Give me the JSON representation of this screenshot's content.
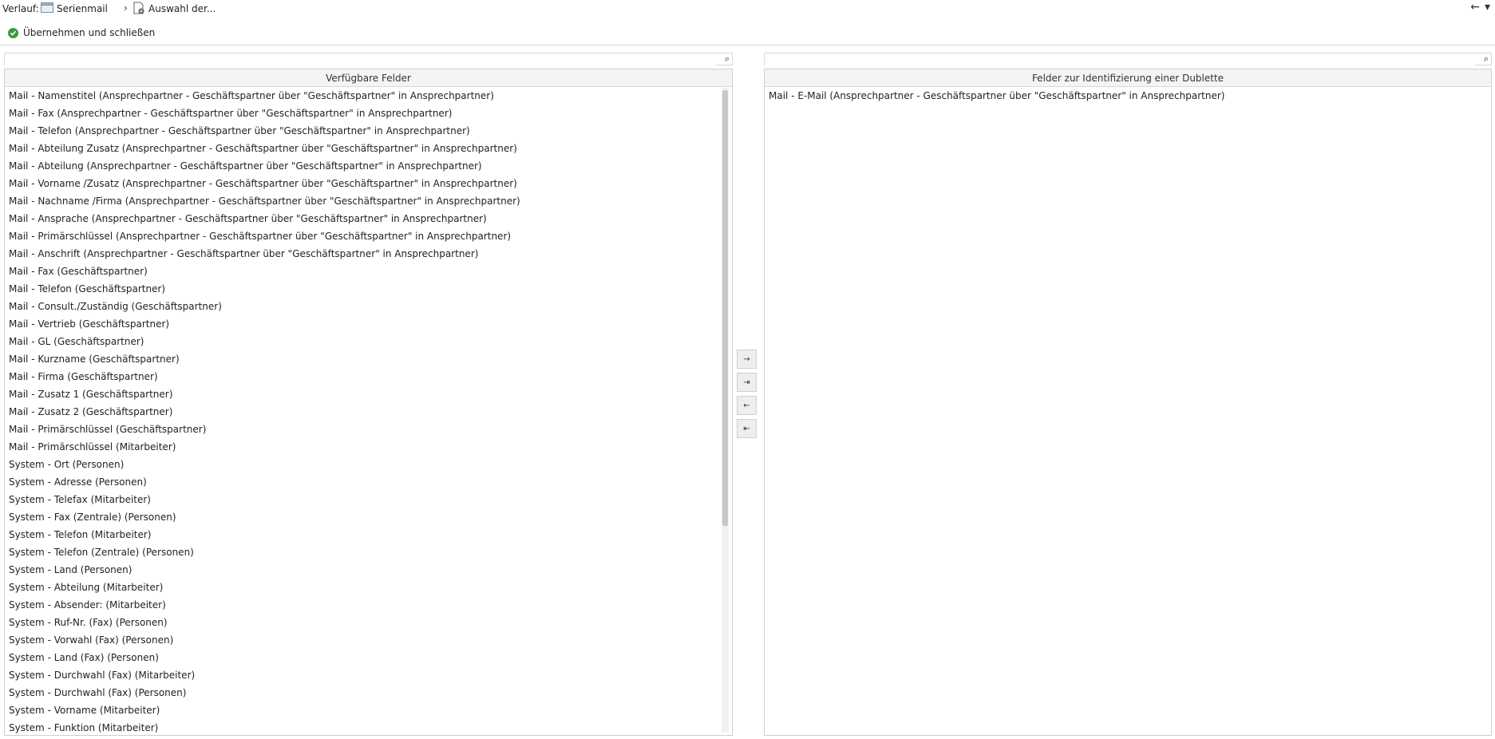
{
  "breadcrumb": {
    "label": "Verlauf:",
    "items": [
      {
        "label": "Serienmail",
        "icon": "window-icon"
      },
      {
        "label": "Auswahl der...",
        "icon": "document-gear-icon"
      }
    ]
  },
  "top_right": {
    "back_icon": "←",
    "menu_icon": "▾"
  },
  "toolbar": {
    "apply_close_label": "Übernehmen und schließen"
  },
  "search_icon": "⌕",
  "left_panel": {
    "header": "Verfügbare Felder",
    "search_value": "",
    "items": [
      "Mail - Namenstitel (Ansprechpartner - Geschäftspartner über \"Geschäftspartner\" in Ansprechpartner)",
      "Mail - Fax (Ansprechpartner - Geschäftspartner über \"Geschäftspartner\" in Ansprechpartner)",
      "Mail - Telefon (Ansprechpartner - Geschäftspartner über \"Geschäftspartner\" in Ansprechpartner)",
      "Mail - Abteilung Zusatz (Ansprechpartner - Geschäftspartner über \"Geschäftspartner\" in Ansprechpartner)",
      "Mail - Abteilung (Ansprechpartner - Geschäftspartner über \"Geschäftspartner\" in Ansprechpartner)",
      "Mail - Vorname /Zusatz (Ansprechpartner - Geschäftspartner über \"Geschäftspartner\" in Ansprechpartner)",
      "Mail - Nachname /Firma (Ansprechpartner - Geschäftspartner über \"Geschäftspartner\" in Ansprechpartner)",
      "Mail - Ansprache (Ansprechpartner - Geschäftspartner über \"Geschäftspartner\" in Ansprechpartner)",
      "Mail - Primärschlüssel (Ansprechpartner - Geschäftspartner über \"Geschäftspartner\" in Ansprechpartner)",
      "Mail - Anschrift (Ansprechpartner - Geschäftspartner über \"Geschäftspartner\" in Ansprechpartner)",
      "Mail - Fax (Geschäftspartner)",
      "Mail - Telefon (Geschäftspartner)",
      "Mail - Consult./Zuständig (Geschäftspartner)",
      "Mail - Vertrieb (Geschäftspartner)",
      "Mail - GL (Geschäftspartner)",
      "Mail - Kurzname (Geschäftspartner)",
      "Mail - Firma (Geschäftspartner)",
      "Mail - Zusatz 1 (Geschäftspartner)",
      "Mail - Zusatz 2 (Geschäftspartner)",
      "Mail - Primärschlüssel (Geschäftspartner)",
      "Mail - Primärschlüssel (Mitarbeiter)",
      "System - Ort (Personen)",
      "System - Adresse (Personen)",
      "System - Telefax (Mitarbeiter)",
      "System - Fax (Zentrale) (Personen)",
      "System - Telefon (Mitarbeiter)",
      "System - Telefon (Zentrale) (Personen)",
      "System - Land (Personen)",
      "System - Abteilung (Mitarbeiter)",
      "System - Absender: (Mitarbeiter)",
      "System - Ruf-Nr. (Fax) (Personen)",
      "System - Vorwahl (Fax) (Personen)",
      "System - Land (Fax) (Personen)",
      "System - Durchwahl (Fax) (Mitarbeiter)",
      "System - Durchwahl (Fax) (Personen)",
      "System - Vorname (Mitarbeiter)",
      "System - Funktion (Mitarbeiter)"
    ]
  },
  "right_panel": {
    "header": "Felder zur Identifizierung einer Dublette",
    "search_value": "",
    "items": [
      "Mail - E-Mail (Ansprechpartner - Geschäftspartner über \"Geschäftspartner\" in Ansprechpartner)"
    ]
  },
  "transfer_buttons": {
    "add": "→",
    "add_all": "⇥",
    "remove": "←",
    "remove_all": "⇤"
  },
  "colors": {
    "ok_green": "#3a9a3a",
    "header_bg": "#f4f4f4"
  }
}
